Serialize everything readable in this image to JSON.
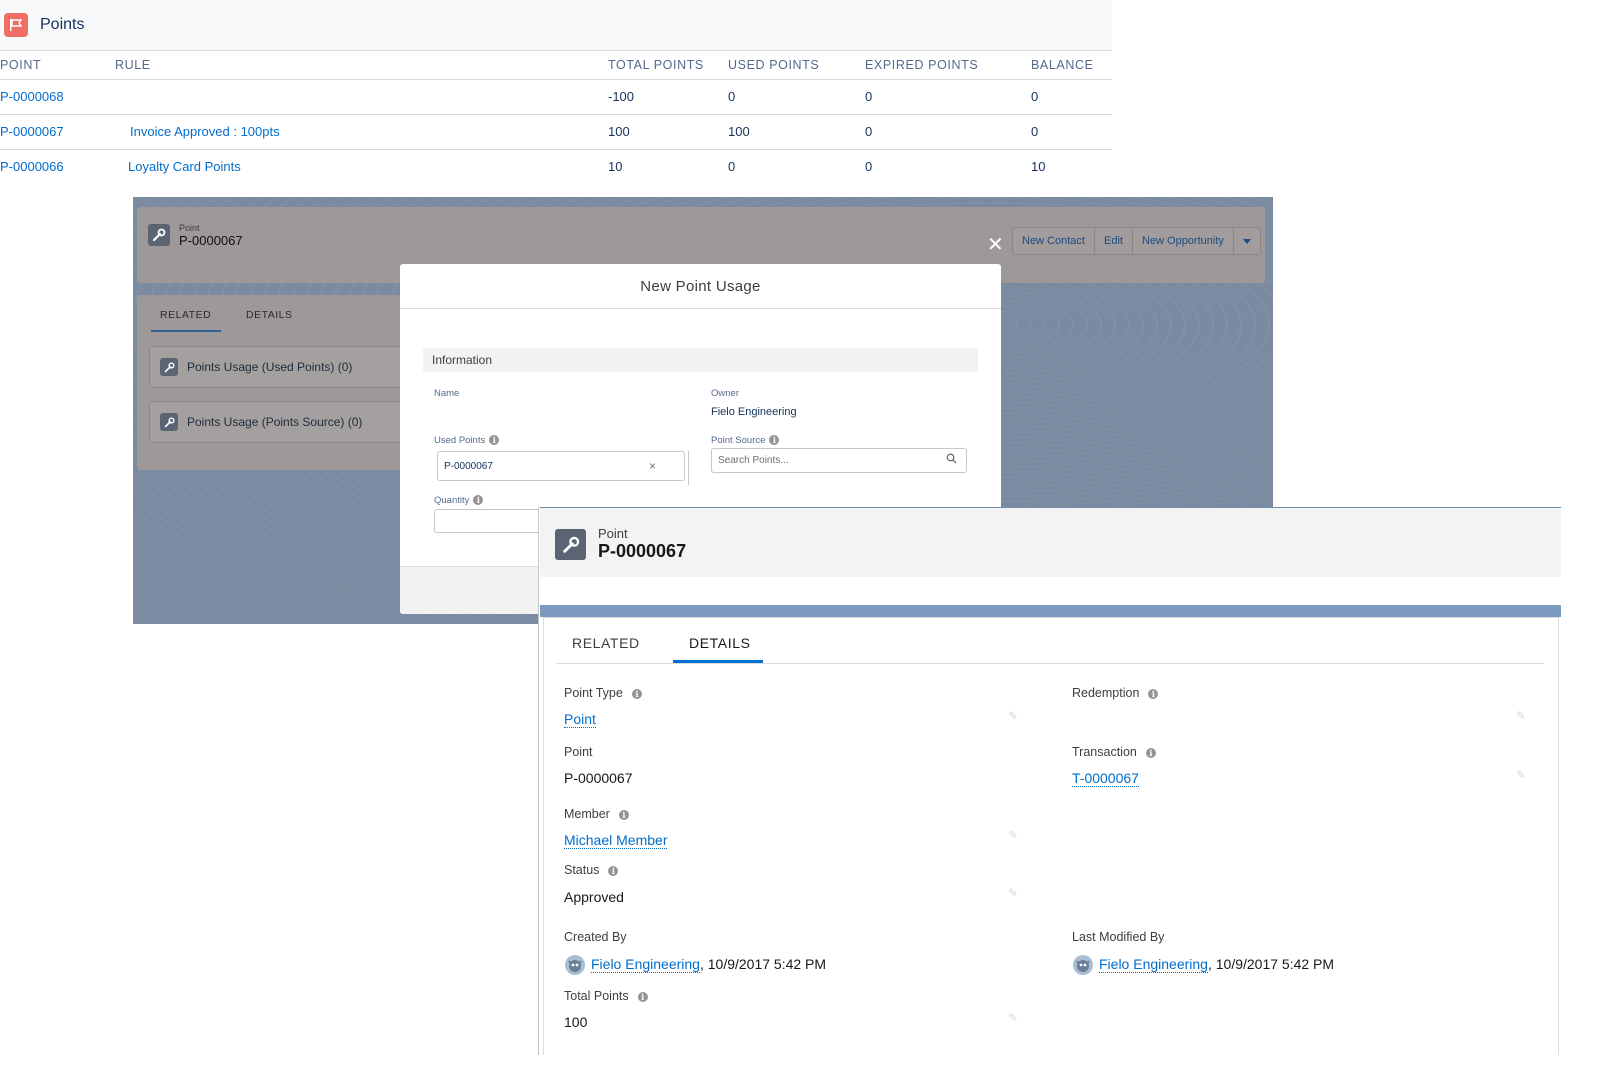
{
  "points_list": {
    "title": "Points",
    "columns": [
      "POINT",
      "RULE",
      "TOTAL POINTS",
      "USED POINTS",
      "EXPIRED POINTS",
      "BALANCE"
    ],
    "rows": [
      {
        "point": "P-0000068",
        "rule": "",
        "total": "-100",
        "used": "0",
        "expired": "0",
        "balance": "0"
      },
      {
        "point": "P-0000067",
        "rule": "Invoice  Approved : 100pts",
        "total": "100",
        "used": "100",
        "expired": "0",
        "balance": "0"
      },
      {
        "point": "P-0000066",
        "rule": "Loyalty Card Points",
        "total": "10",
        "used": "0",
        "expired": "0",
        "balance": "10"
      }
    ]
  },
  "bg_record": {
    "object_label": "Point",
    "record_name": "P-0000067",
    "actions": [
      "New Contact",
      "Edit",
      "New Opportunity"
    ],
    "tabs": [
      "RELATED",
      "DETAILS"
    ],
    "related_lists": [
      "Points Usage (Used Points) (0)",
      "Points Usage (Points Source) (0)"
    ]
  },
  "modal": {
    "title": "New Point Usage",
    "section": "Information",
    "name_label": "Name",
    "owner_label": "Owner",
    "owner_value": "Fielo Engineering",
    "used_points_label": "Used Points",
    "used_points_value": "P-0000067",
    "point_source_label": "Point Source",
    "point_source_placeholder": "Search Points...",
    "quantity_label": "Quantity",
    "close_glyph": "✕"
  },
  "detail": {
    "object_label": "Point",
    "record_name": "P-0000067",
    "tabs": {
      "related": "RELATED",
      "details": "DETAILS"
    },
    "fields": {
      "point_type_label": "Point Type",
      "point_type_value": "Point",
      "redemption_label": "Redemption",
      "point_label": "Point",
      "point_value": "P-0000067",
      "transaction_label": "Transaction",
      "transaction_value": "T-0000067",
      "member_label": "Member",
      "member_value": "Michael Member",
      "status_label": "Status",
      "status_value": "Approved",
      "created_by_label": "Created By",
      "created_by_user": "Fielo Engineering",
      "created_by_date": ", 10/9/2017 5:42 PM",
      "last_modified_label": "Last Modified By",
      "last_modified_user": "Fielo Engineering",
      "last_modified_date": ", 10/9/2017 5:42 PM",
      "total_points_label": "Total Points",
      "total_points_value": "100"
    }
  },
  "colors": {
    "link": "#006dcc",
    "flag_icon_bg": "#ef6e64",
    "record_icon_bg": "#5a6472",
    "active_tab": "#0070d2"
  },
  "icons": [
    "flag-icon",
    "wrench-icon",
    "close-icon",
    "info-icon",
    "search-icon",
    "clear-icon",
    "chevron-down-icon",
    "pencil-icon",
    "avatar-icon"
  ]
}
